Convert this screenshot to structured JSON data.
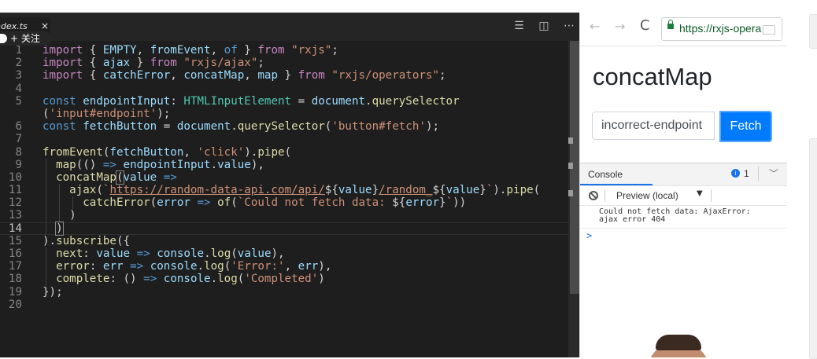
{
  "editor": {
    "tab_label": "ndex.ts",
    "tab_close": "×",
    "follow_label": "+ 关注",
    "actions": [
      "☰",
      "◫",
      "⋯"
    ],
    "code_lines": [
      {
        "n": "1"
      },
      {
        "n": "2"
      },
      {
        "n": "3"
      },
      {
        "n": "4"
      },
      {
        "n": "5"
      },
      {
        "n": "6"
      },
      {
        "n": "7"
      },
      {
        "n": "8"
      },
      {
        "n": "9"
      },
      {
        "n": "10"
      },
      {
        "n": "11"
      },
      {
        "n": "12"
      },
      {
        "n": "13"
      },
      {
        "n": "14"
      },
      {
        "n": "15"
      },
      {
        "n": "16"
      },
      {
        "n": "17"
      },
      {
        "n": "18"
      },
      {
        "n": "19"
      },
      {
        "n": "20"
      }
    ]
  },
  "browser": {
    "nav_back": "←",
    "nav_forward": "→",
    "nav_reload": "C",
    "url": "https://rxjs-opera",
    "page_title": "concatMap",
    "endpoint_value": "incorrect-endpoint",
    "fetch_label": "Fetch",
    "devtools": {
      "tab_label": "Console",
      "info_count": "1",
      "context_label": "Preview (local)",
      "message": "Could not fetch data: AjaxError:\najax error 404",
      "prompt": ">"
    }
  },
  "colors": {
    "editor_bg": "#1e1e1e",
    "keyword_blue": "#569cd6",
    "keyword_purple": "#c586c0",
    "string": "#ce9178",
    "function": "#dcdcaa",
    "primary_button": "#007bff"
  }
}
